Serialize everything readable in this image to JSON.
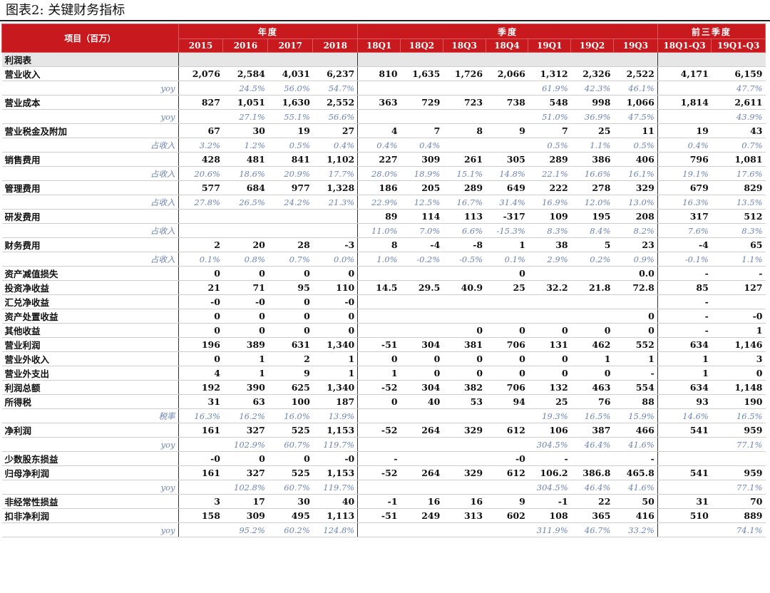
{
  "figure_title": "图表2:  关键财务指标",
  "header": {
    "project_label": "项目（百万）",
    "groups": [
      {
        "label": "年度",
        "span": 4
      },
      {
        "label": "季度",
        "span": 7
      },
      {
        "label": "前三季度",
        "span": 2
      }
    ],
    "columns": [
      "2015",
      "2016",
      "2017",
      "2018",
      "18Q1",
      "18Q2",
      "18Q3",
      "18Q4",
      "19Q1",
      "19Q2",
      "19Q3",
      "18Q1-Q3",
      "19Q1-Q3"
    ]
  },
  "rows": [
    {
      "type": "section",
      "label": "利润表",
      "values": [
        "",
        "",
        "",
        "",
        "",
        "",
        "",
        "",
        "",
        "",
        "",
        "",
        ""
      ]
    },
    {
      "type": "main",
      "label": "营业收入",
      "values": [
        "2,076",
        "2,584",
        "4,031",
        "6,237",
        "810",
        "1,635",
        "1,726",
        "2,066",
        "1,312",
        "2,326",
        "2,522",
        "4,171",
        "6,159"
      ]
    },
    {
      "type": "sub",
      "label": "yoy",
      "values": [
        "",
        "24.5%",
        "56.0%",
        "54.7%",
        "",
        "",
        "",
        "",
        "61.9%",
        "42.3%",
        "46.1%",
        "",
        "47.7%"
      ]
    },
    {
      "type": "main",
      "label": "营业成本",
      "values": [
        "827",
        "1,051",
        "1,630",
        "2,552",
        "363",
        "729",
        "723",
        "738",
        "548",
        "998",
        "1,066",
        "1,814",
        "2,611"
      ]
    },
    {
      "type": "sub",
      "label": "yoy",
      "values": [
        "",
        "27.1%",
        "55.1%",
        "56.6%",
        "",
        "",
        "",
        "",
        "51.0%",
        "36.9%",
        "47.5%",
        "",
        "43.9%"
      ]
    },
    {
      "type": "main",
      "label": "营业税金及附加",
      "values": [
        "67",
        "30",
        "19",
        "27",
        "4",
        "7",
        "8",
        "9",
        "7",
        "25",
        "11",
        "19",
        "43"
      ]
    },
    {
      "type": "sub",
      "label": "占收入",
      "values": [
        "3.2%",
        "1.2%",
        "0.5%",
        "0.4%",
        "0.4%",
        "0.4%",
        "",
        "",
        "0.5%",
        "1.1%",
        "0.5%",
        "0.4%",
        "0.7%"
      ]
    },
    {
      "type": "main",
      "label": "销售费用",
      "values": [
        "428",
        "481",
        "841",
        "1,102",
        "227",
        "309",
        "261",
        "305",
        "289",
        "386",
        "406",
        "796",
        "1,081"
      ]
    },
    {
      "type": "sub",
      "label": "占收入",
      "values": [
        "20.6%",
        "18.6%",
        "20.9%",
        "17.7%",
        "28.0%",
        "18.9%",
        "15.1%",
        "14.8%",
        "22.1%",
        "16.6%",
        "16.1%",
        "19.1%",
        "17.6%"
      ]
    },
    {
      "type": "main",
      "label": "管理费用",
      "values": [
        "577",
        "684",
        "977",
        "1,328",
        "186",
        "205",
        "289",
        "649",
        "222",
        "278",
        "329",
        "679",
        "829"
      ]
    },
    {
      "type": "sub",
      "label": "占收入",
      "values": [
        "27.8%",
        "26.5%",
        "24.2%",
        "21.3%",
        "22.9%",
        "12.5%",
        "16.7%",
        "31.4%",
        "16.9%",
        "12.0%",
        "13.0%",
        "16.3%",
        "13.5%"
      ]
    },
    {
      "type": "main",
      "label": "研发费用",
      "values": [
        "",
        "",
        "",
        "",
        "89",
        "114",
        "113",
        "-317",
        "109",
        "195",
        "208",
        "317",
        "512"
      ]
    },
    {
      "type": "sub",
      "label": "占收入",
      "values": [
        "",
        "",
        "",
        "",
        "11.0%",
        "7.0%",
        "6.6%",
        "-15.3%",
        "8.3%",
        "8.4%",
        "8.2%",
        "7.6%",
        "8.3%"
      ]
    },
    {
      "type": "main",
      "label": "财务费用",
      "values": [
        "2",
        "20",
        "28",
        "-3",
        "8",
        "-4",
        "-8",
        "1",
        "38",
        "5",
        "23",
        "-4",
        "65"
      ]
    },
    {
      "type": "sub",
      "label": "占收入",
      "values": [
        "0.1%",
        "0.8%",
        "0.7%",
        "0.0%",
        "1.0%",
        "-0.2%",
        "-0.5%",
        "0.1%",
        "2.9%",
        "0.2%",
        "0.9%",
        "-0.1%",
        "1.1%"
      ]
    },
    {
      "type": "main",
      "label": "资产减值损失",
      "values": [
        "0",
        "0",
        "0",
        "0",
        "",
        "",
        "",
        "0",
        "",
        "",
        "0.0",
        "-",
        "-"
      ]
    },
    {
      "type": "main",
      "label": "投资净收益",
      "values": [
        "21",
        "71",
        "95",
        "110",
        "14.5",
        "29.5",
        "40.9",
        "25",
        "32.2",
        "21.8",
        "72.8",
        "85",
        "127"
      ]
    },
    {
      "type": "main",
      "label": "汇兑净收益",
      "values": [
        "-0",
        "-0",
        "0",
        "-0",
        "",
        "",
        "",
        "",
        "",
        "",
        "",
        "-",
        ""
      ]
    },
    {
      "type": "main",
      "label": "资产处置收益",
      "values": [
        "0",
        "0",
        "0",
        "0",
        "",
        "",
        "",
        "",
        "",
        "",
        "0",
        "-",
        "-0"
      ]
    },
    {
      "type": "main",
      "label": "其他收益",
      "values": [
        "0",
        "0",
        "0",
        "0",
        "",
        "",
        "0",
        "0",
        "0",
        "0",
        "0",
        "-",
        "1"
      ]
    },
    {
      "type": "main",
      "label": "营业利润",
      "values": [
        "196",
        "389",
        "631",
        "1,340",
        "-51",
        "304",
        "381",
        "706",
        "131",
        "462",
        "552",
        "634",
        "1,146"
      ]
    },
    {
      "type": "main",
      "label": "营业外收入",
      "values": [
        "0",
        "1",
        "2",
        "1",
        "0",
        "0",
        "0",
        "0",
        "0",
        "1",
        "1",
        "1",
        "3"
      ]
    },
    {
      "type": "main",
      "label": "营业外支出",
      "values": [
        "4",
        "1",
        "9",
        "1",
        "1",
        "0",
        "0",
        "0",
        "0",
        "0",
        "-",
        "1",
        "0"
      ]
    },
    {
      "type": "main",
      "label": "利润总额",
      "values": [
        "192",
        "390",
        "625",
        "1,340",
        "-52",
        "304",
        "382",
        "706",
        "132",
        "463",
        "554",
        "634",
        "1,148"
      ]
    },
    {
      "type": "main",
      "label": "所得税",
      "values": [
        "31",
        "63",
        "100",
        "187",
        "0",
        "40",
        "53",
        "94",
        "25",
        "76",
        "88",
        "93",
        "190"
      ]
    },
    {
      "type": "sub",
      "label": "税率",
      "values": [
        "16.3%",
        "16.2%",
        "16.0%",
        "13.9%",
        "",
        "",
        "",
        "",
        "19.3%",
        "16.5%",
        "15.9%",
        "14.6%",
        "16.5%"
      ]
    },
    {
      "type": "main",
      "label": "净利润",
      "values": [
        "161",
        "327",
        "525",
        "1,153",
        "-52",
        "264",
        "329",
        "612",
        "106",
        "387",
        "466",
        "541",
        "959"
      ]
    },
    {
      "type": "sub",
      "label": "yoy",
      "values": [
        "",
        "102.9%",
        "60.7%",
        "119.7%",
        "",
        "",
        "",
        "",
        "304.5%",
        "46.4%",
        "41.6%",
        "",
        "77.1%"
      ]
    },
    {
      "type": "main",
      "label": "少数股东损益",
      "values": [
        "-0",
        "0",
        "0",
        "-0",
        "-",
        "",
        "",
        "-0",
        "-",
        "",
        "-",
        "",
        ""
      ]
    },
    {
      "type": "main",
      "label": "归母净利润",
      "values": [
        "161",
        "327",
        "525",
        "1,153",
        "-52",
        "264",
        "329",
        "612",
        "106.2",
        "386.8",
        "465.8",
        "541",
        "959"
      ]
    },
    {
      "type": "sub",
      "label": "yoy",
      "values": [
        "",
        "102.8%",
        "60.7%",
        "119.7%",
        "",
        "",
        "",
        "",
        "304.5%",
        "46.4%",
        "41.6%",
        "",
        "77.1%"
      ]
    },
    {
      "type": "main",
      "label": "非经常性损益",
      "values": [
        "3",
        "17",
        "30",
        "40",
        "-1",
        "16",
        "16",
        "9",
        "-1",
        "22",
        "50",
        "31",
        "70"
      ]
    },
    {
      "type": "main",
      "label": "扣非净利润",
      "values": [
        "158",
        "309",
        "495",
        "1,113",
        "-51",
        "249",
        "313",
        "602",
        "108",
        "365",
        "416",
        "510",
        "889"
      ]
    },
    {
      "type": "sub",
      "label": "yoy",
      "values": [
        "",
        "95.2%",
        "60.2%",
        "124.8%",
        "",
        "",
        "",
        "",
        "311.9%",
        "46.7%",
        "33.2%",
        "",
        "74.1%"
      ]
    }
  ]
}
